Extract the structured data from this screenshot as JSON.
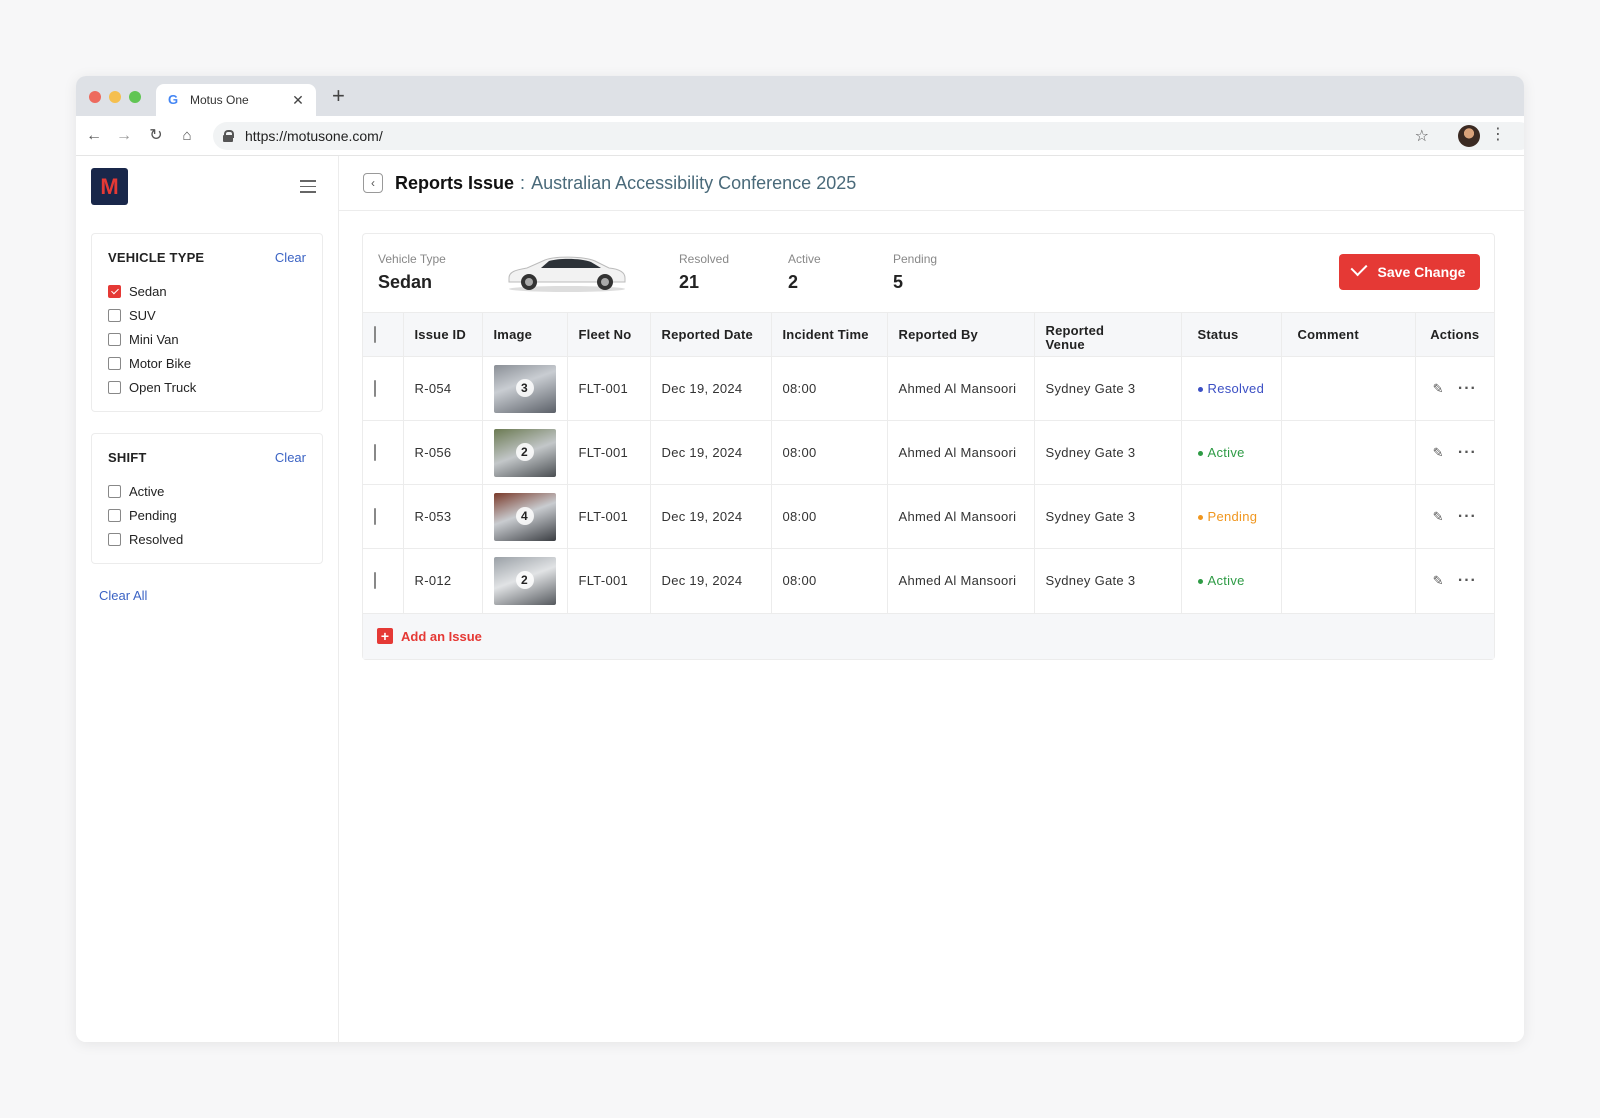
{
  "browser": {
    "tab_title": "Motus One",
    "url": "https://motusone.com/",
    "traffic_colors": [
      "#ed6a5e",
      "#f5bf4f",
      "#61c554"
    ]
  },
  "sidebar": {
    "logo_text": "M",
    "vehicle_type": {
      "title": "VEHICLE TYPE",
      "clear_label": "Clear",
      "options": [
        {
          "label": "Sedan",
          "checked": true
        },
        {
          "label": "SUV",
          "checked": false
        },
        {
          "label": "Mini Van",
          "checked": false
        },
        {
          "label": "Motor Bike",
          "checked": false
        },
        {
          "label": "Open Truck",
          "checked": false
        }
      ]
    },
    "shift": {
      "title": "SHIFT",
      "clear_label": "Clear",
      "options": [
        {
          "label": "Active",
          "checked": false
        },
        {
          "label": "Pending",
          "checked": false
        },
        {
          "label": "Resolved",
          "checked": false
        }
      ]
    },
    "clear_all_label": "Clear All"
  },
  "header": {
    "title": "Reports Issue",
    "separator": ":",
    "event": "Australian Accessibility Conference 2025"
  },
  "summary": {
    "vehicle_type_label": "Vehicle Type",
    "vehicle_type_value": "Sedan",
    "resolved_label": "Resolved",
    "resolved_value": "21",
    "active_label": "Active",
    "active_value": "2",
    "pending_label": "Pending",
    "pending_value": "5",
    "save_label": "Save Change"
  },
  "table": {
    "columns": [
      "Issue ID",
      "Image",
      "Fleet No",
      "Reported Date",
      "Incident Time",
      "Reported By",
      "Reported Venue",
      "Status",
      "Comment",
      "Actions"
    ],
    "rows": [
      {
        "id": "R-054",
        "image_count": "3",
        "fleet": "FLT-001",
        "date": "Dec 19, 2024",
        "time": "08:00",
        "by": "Ahmed Al Mansoori",
        "venue": "Sydney Gate 3",
        "status": "Resolved",
        "comment": ""
      },
      {
        "id": "R-056",
        "image_count": "2",
        "fleet": "FLT-001",
        "date": "Dec 19, 2024",
        "time": "08:00",
        "by": "Ahmed Al Mansoori",
        "venue": "Sydney Gate 3",
        "status": "Active",
        "comment": ""
      },
      {
        "id": "R-053",
        "image_count": "4",
        "fleet": "FLT-001",
        "date": "Dec 19, 2024",
        "time": "08:00",
        "by": "Ahmed Al Mansoori",
        "venue": "Sydney Gate 3",
        "status": "Pending",
        "comment": ""
      },
      {
        "id": "R-012",
        "image_count": "2",
        "fleet": "FLT-001",
        "date": "Dec 19, 2024",
        "time": "08:00",
        "by": "Ahmed Al Mansoori",
        "venue": "Sydney Gate 3",
        "status": "Active",
        "comment": ""
      }
    ],
    "status_colors": {
      "Resolved": "#3b4fc4",
      "Active": "#2e9b45",
      "Pending": "#f0961e"
    },
    "add_label": "Add an Issue"
  },
  "colors": {
    "accent": "#e53935",
    "link": "#3b63c4"
  }
}
